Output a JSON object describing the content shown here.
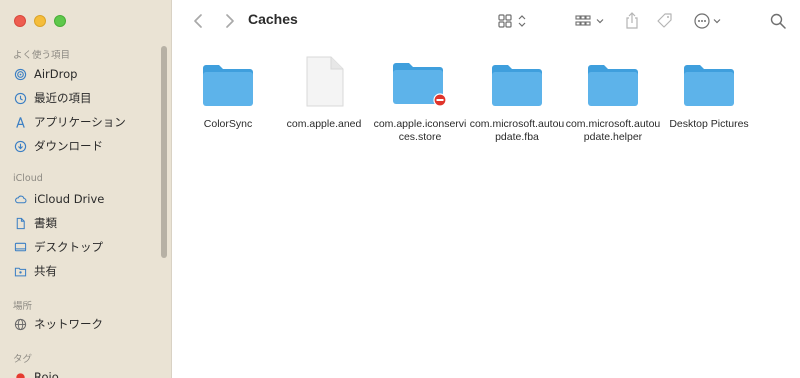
{
  "window": {
    "title": "Caches"
  },
  "sidebar": {
    "favorites_title": "よく使う項目",
    "favorites": [
      {
        "label": "AirDrop",
        "icon": "airdrop-icon"
      },
      {
        "label": "最近の項目",
        "icon": "clock-icon"
      },
      {
        "label": "アプリケーション",
        "icon": "applications-icon"
      },
      {
        "label": "ダウンロード",
        "icon": "download-icon"
      }
    ],
    "icloud_title": "iCloud",
    "icloud": [
      {
        "label": "iCloud Drive",
        "icon": "cloud-icon"
      },
      {
        "label": "書類",
        "icon": "document-icon"
      },
      {
        "label": "デスクトップ",
        "icon": "desktop-icon"
      },
      {
        "label": "共有",
        "icon": "shared-folder-icon"
      }
    ],
    "locations_title": "場所",
    "locations": [
      {
        "label": "ネットワーク",
        "icon": "network-icon"
      }
    ],
    "tags_title": "タグ",
    "tags": [
      {
        "label": "Rojo",
        "color": "#e53b30"
      }
    ]
  },
  "toolbar": {
    "back_icon": "chevron-left-icon",
    "forward_icon": "chevron-right-icon",
    "view_icon": "icon-grid-view-icon",
    "group_icon": "group-by-icon",
    "share_icon": "share-icon",
    "tag_icon": "tag-icon",
    "more_icon": "ellipsis-circle-icon",
    "search_icon": "search-icon"
  },
  "files": [
    {
      "name": "ColorSync",
      "type": "folder"
    },
    {
      "name": "com.apple.aned",
      "type": "file"
    },
    {
      "name": "com.apple.iconservices.store",
      "type": "folder-restricted"
    },
    {
      "name": "com.microsoft.autoupdate.fba",
      "type": "folder"
    },
    {
      "name": "com.microsoft.autoupdate.helper",
      "type": "folder"
    },
    {
      "name": "Desktop Pictures",
      "type": "folder"
    }
  ],
  "colors": {
    "sidebar_bg": "#eae3d4",
    "folder": "#5db3ea",
    "folder_dark": "#3f9fdd",
    "restricted": "#e0352b"
  }
}
